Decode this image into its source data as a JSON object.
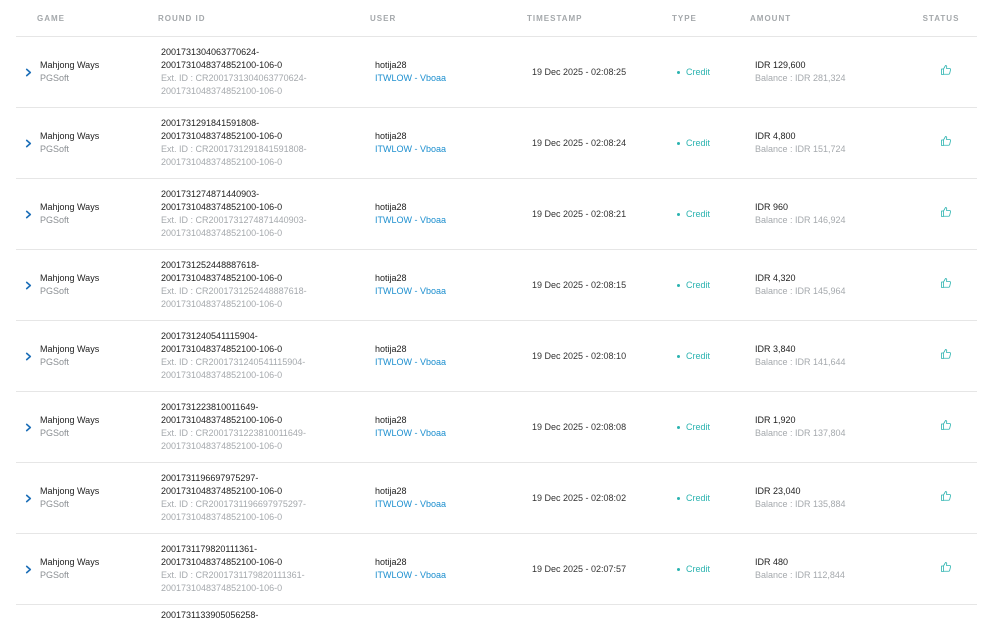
{
  "headers": {
    "game": "GAME",
    "round_id": "ROUND ID",
    "user": "USER",
    "timestamp": "TIMESTAMP",
    "type": "TYPE",
    "amount": "AMOUNT",
    "status": "STATUS"
  },
  "colors": {
    "accent": "#2bb3b0",
    "link": "#1d8fcf",
    "muted": "#a5a9ad",
    "chevron": "#1d6fb8"
  },
  "rows": [
    {
      "game": "Mahjong Ways",
      "provider": "PGSoft",
      "round_id_1": "2001731304063770624-",
      "round_id_2": "2001731048374852100-106-0",
      "ext_1": "Ext. ID : CR2001731304063770624-",
      "ext_2": "2001731048374852100-106-0",
      "user": "hotija28",
      "agent": "ITWLOW - Vboaa",
      "timestamp": "19 Dec 2025 - 02:08:25",
      "type": "Credit",
      "amount": "IDR 129,600",
      "balance": "Balance : IDR 281,324",
      "status_icon": "thumbs-up-icon"
    },
    {
      "game": "Mahjong Ways",
      "provider": "PGSoft",
      "round_id_1": "2001731291841591808-",
      "round_id_2": "2001731048374852100-106-0",
      "ext_1": "Ext. ID : CR2001731291841591808-",
      "ext_2": "2001731048374852100-106-0",
      "user": "hotija28",
      "agent": "ITWLOW - Vboaa",
      "timestamp": "19 Dec 2025 - 02:08:24",
      "type": "Credit",
      "amount": "IDR 4,800",
      "balance": "Balance : IDR 151,724",
      "status_icon": "thumbs-up-icon"
    },
    {
      "game": "Mahjong Ways",
      "provider": "PGSoft",
      "round_id_1": "2001731274871440903-",
      "round_id_2": "2001731048374852100-106-0",
      "ext_1": "Ext. ID : CR2001731274871440903-",
      "ext_2": "2001731048374852100-106-0",
      "user": "hotija28",
      "agent": "ITWLOW - Vboaa",
      "timestamp": "19 Dec 2025 - 02:08:21",
      "type": "Credit",
      "amount": "IDR 960",
      "balance": "Balance : IDR 146,924",
      "status_icon": "thumbs-up-icon"
    },
    {
      "game": "Mahjong Ways",
      "provider": "PGSoft",
      "round_id_1": "2001731252448887618-",
      "round_id_2": "2001731048374852100-106-0",
      "ext_1": "Ext. ID : CR2001731252448887618-",
      "ext_2": "2001731048374852100-106-0",
      "user": "hotija28",
      "agent": "ITWLOW - Vboaa",
      "timestamp": "19 Dec 2025 - 02:08:15",
      "type": "Credit",
      "amount": "IDR 4,320",
      "balance": "Balance : IDR 145,964",
      "status_icon": "thumbs-up-icon"
    },
    {
      "game": "Mahjong Ways",
      "provider": "PGSoft",
      "round_id_1": "2001731240541115904-",
      "round_id_2": "2001731048374852100-106-0",
      "ext_1": "Ext. ID : CR2001731240541115904-",
      "ext_2": "2001731048374852100-106-0",
      "user": "hotija28",
      "agent": "ITWLOW - Vboaa",
      "timestamp": "19 Dec 2025 - 02:08:10",
      "type": "Credit",
      "amount": "IDR 3,840",
      "balance": "Balance : IDR 141,644",
      "status_icon": "thumbs-up-icon"
    },
    {
      "game": "Mahjong Ways",
      "provider": "PGSoft",
      "round_id_1": "2001731223810011649-",
      "round_id_2": "2001731048374852100-106-0",
      "ext_1": "Ext. ID : CR2001731223810011649-",
      "ext_2": "2001731048374852100-106-0",
      "user": "hotija28",
      "agent": "ITWLOW - Vboaa",
      "timestamp": "19 Dec 2025 - 02:08:08",
      "type": "Credit",
      "amount": "IDR 1,920",
      "balance": "Balance : IDR 137,804",
      "status_icon": "thumbs-up-icon"
    },
    {
      "game": "Mahjong Ways",
      "provider": "PGSoft",
      "round_id_1": "2001731196697975297-",
      "round_id_2": "2001731048374852100-106-0",
      "ext_1": "Ext. ID : CR2001731196697975297-",
      "ext_2": "2001731048374852100-106-0",
      "user": "hotija28",
      "agent": "ITWLOW - Vboaa",
      "timestamp": "19 Dec 2025 - 02:08:02",
      "type": "Credit",
      "amount": "IDR 23,040",
      "balance": "Balance : IDR 135,884",
      "status_icon": "thumbs-up-icon"
    },
    {
      "game": "Mahjong Ways",
      "provider": "PGSoft",
      "round_id_1": "2001731179820111361-",
      "round_id_2": "2001731048374852100-106-0",
      "ext_1": "Ext. ID : CR2001731179820111361-",
      "ext_2": "2001731048374852100-106-0",
      "user": "hotija28",
      "agent": "ITWLOW - Vboaa",
      "timestamp": "19 Dec 2025 - 02:07:57",
      "type": "Credit",
      "amount": "IDR 480",
      "balance": "Balance : IDR 112,844",
      "status_icon": "thumbs-up-icon"
    }
  ],
  "partial_row": {
    "round_id_1": "2001731133905056258-"
  }
}
